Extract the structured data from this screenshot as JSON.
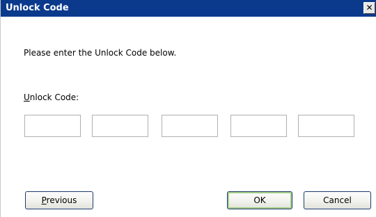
{
  "window": {
    "title": "Unlock Code",
    "close_glyph": "✕"
  },
  "body": {
    "instruction": "Please enter the Unlock Code below.",
    "field_label_mnemonic": "U",
    "field_label_rest": "nlock Code:"
  },
  "code_fields": [
    {
      "value": ""
    },
    {
      "value": ""
    },
    {
      "value": ""
    },
    {
      "value": ""
    },
    {
      "value": ""
    }
  ],
  "buttons": {
    "previous_mnemonic": "P",
    "previous_rest": "revious",
    "ok": "OK",
    "cancel": "Cancel"
  },
  "colors": {
    "titlebar": "#0b3a8c",
    "button_border": "#1c3a6e",
    "default_button_focus": "#a8d08a"
  }
}
